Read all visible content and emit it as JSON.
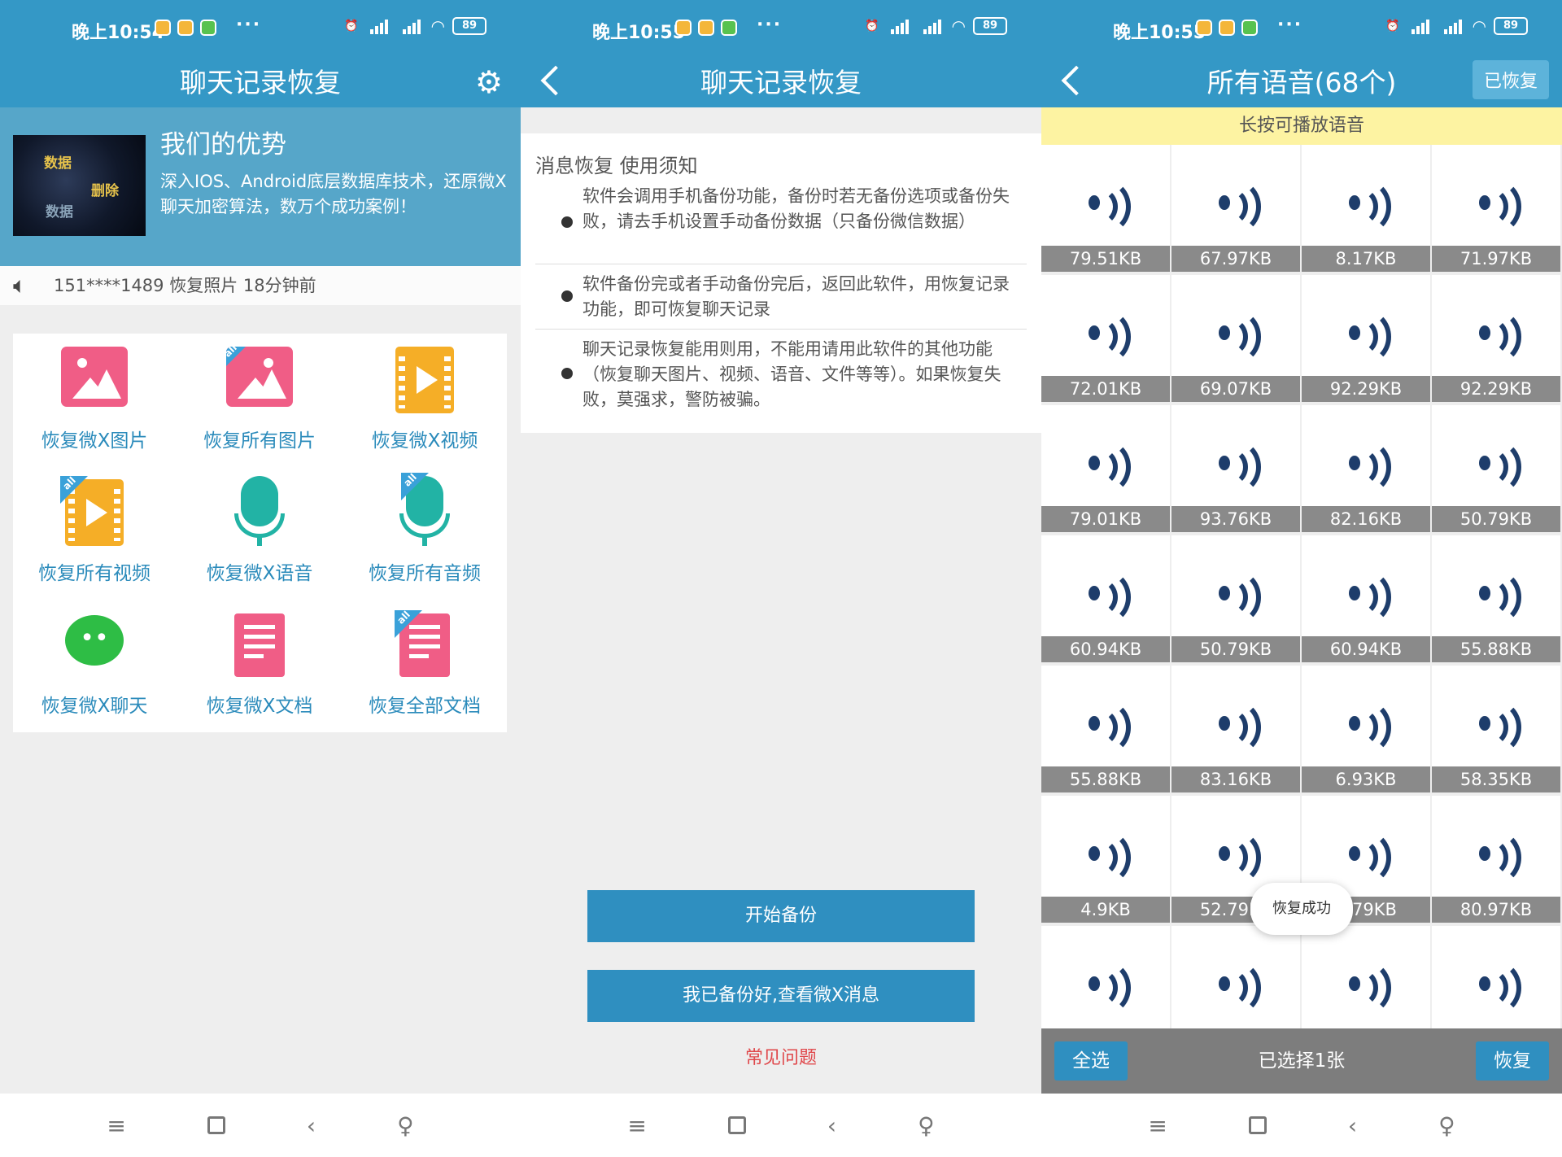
{
  "status_bars": [
    {
      "time": "晚上10:54",
      "battery": "89"
    },
    {
      "time": "晚上10:55",
      "battery": "89"
    },
    {
      "time": "晚上10:55",
      "battery": "89"
    }
  ],
  "colors": {
    "primary": "#3498c6",
    "banner": "#56a6c9",
    "link": "#2b8bbb",
    "warning_link": "#e0484b",
    "hint": "#fdf3a2"
  },
  "screen1": {
    "title": "聊天记录恢复",
    "banner": {
      "title": "我们的优势",
      "desc": "深入IOS、Android底层数据库技术，还原微X聊天加密算法，数万个成功案例！",
      "img_words": [
        "数据",
        "删除",
        "数据"
      ]
    },
    "notice": {
      "text": "151****1489  恢复照片  18分钟前"
    },
    "items": [
      {
        "label": "恢复微X图片",
        "icon": "photo-icon"
      },
      {
        "label": "恢复所有图片",
        "icon": "all-photo-icon"
      },
      {
        "label": "恢复微X视频",
        "icon": "video-icon"
      },
      {
        "label": "恢复所有视频",
        "icon": "all-video-icon"
      },
      {
        "label": "恢复微X语音",
        "icon": "microphone-icon"
      },
      {
        "label": "恢复所有音频",
        "icon": "all-audio-icon"
      },
      {
        "label": "恢复微X聊天",
        "icon": "chat-icon"
      },
      {
        "label": "恢复微X文档",
        "icon": "document-icon"
      },
      {
        "label": "恢复全部文档",
        "icon": "all-document-icon"
      }
    ],
    "all_tag": "all"
  },
  "screen2": {
    "title": "聊天记录恢复",
    "notes_title": "消息恢复 使用须知",
    "notes": [
      "软件会调用手机备份功能，备份时若无备份选项或备份失败，请去手机设置手动备份数据（只备份微信数据）",
      "软件备份完或者手动备份完后，返回此软件，用恢复记录功能，即可恢复聊天记录",
      "聊天记录恢复能用则用，不能用请用此软件的其他功能（恢复聊天图片、视频、语音、文件等等）。如果恢复失败，莫强求，警防被骗。"
    ],
    "start_backup": "开始备份",
    "view_messages": "我已备份好,查看微X消息",
    "faq": "常见问题"
  },
  "screen3": {
    "title": "所有语音(68个)",
    "restored_button": "已恢复",
    "hint": "长按可播放语音",
    "voices": [
      "79.51KB",
      "67.97KB",
      "8.17KB",
      "71.97KB",
      "72.01KB",
      "69.07KB",
      "92.29KB",
      "92.29KB",
      "79.01KB",
      "93.76KB",
      "82.16KB",
      "50.79KB",
      "60.94KB",
      "50.79KB",
      "60.94KB",
      "55.88KB",
      "55.88KB",
      "83.16KB",
      "6.93KB",
      "58.35KB",
      "4.9KB",
      "52.79KB",
      "…79KB",
      "80.97KB",
      "",
      "",
      "",
      ""
    ],
    "toast": "恢复成功",
    "select_all": "全选",
    "selected_count": "已选择1张",
    "restore": "恢复"
  },
  "nav": {
    "menu": "≡",
    "back": "‹",
    "accessibility": "accessibility-icon"
  }
}
